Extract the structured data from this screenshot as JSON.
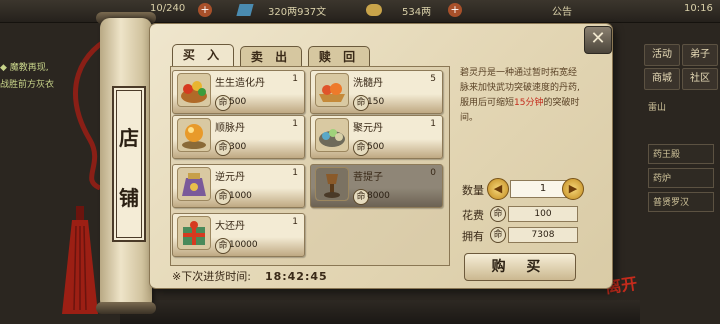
{
  "hud": {
    "stamina": "10/240",
    "copper": "320两937文",
    "silver": "534两",
    "notice_label": "公告",
    "clock": "10:16"
  },
  "side_text": {
    "line1": "◆ 魔教再现,",
    "line2": "战胜前方灰衣"
  },
  "right_menu": {
    "btn_activity": "活动",
    "btn_disciple": "弟子",
    "btn_shop": "商城",
    "btn_community": "社区",
    "label_area": "雷山",
    "item1": "药王殿",
    "item2": "药炉",
    "item3": "普贤罗汉"
  },
  "shop": {
    "title_top": "店",
    "title_bottom": "铺",
    "tabs": [
      "买 入",
      "卖 出",
      "赎 回"
    ],
    "items": [
      {
        "name": "生生造化丹",
        "qty": "1",
        "price": "500",
        "icon": "pill-basket-icon"
      },
      {
        "name": "洗髓丹",
        "qty": "5",
        "price": "150",
        "icon": "orange-pills-icon"
      },
      {
        "name": "顺脉丹",
        "qty": "1",
        "price": "300",
        "icon": "blue-orb-icon"
      },
      {
        "name": "聚元丹",
        "qty": "1",
        "price": "500",
        "icon": "jade-pills-icon"
      },
      {
        "name": "逆元丹",
        "qty": "1",
        "price": "1000",
        "icon": "pouch-icon"
      },
      {
        "name": "菩提子",
        "qty": "0",
        "price": "8000",
        "icon": "incense-icon"
      },
      {
        "name": "大还丹",
        "qty": "1",
        "price": "10000",
        "icon": "gift-box-icon"
      }
    ],
    "restock_label": "※下次进货时间:",
    "restock_time": "18:42:45",
    "description_pre": "碧灵丹是一种通过暂时拓宽经脉来加快武功突破速度的丹药,服用后可缩短",
    "description_highlight": "15分钟",
    "description_post": "的突破时间。",
    "quantity_label": "数量",
    "quantity_value": "1",
    "cost_label": "花费",
    "cost_value": "100",
    "owned_label": "拥有",
    "owned_value": "7308",
    "buy_label": "购 买",
    "currency_symbol": "命"
  },
  "brand": "离开",
  "colors": {
    "highlight_red": "#c42b1c",
    "parchment": "#efe6cd",
    "ink": "#3a2a18",
    "gold": "#c18a1e"
  }
}
